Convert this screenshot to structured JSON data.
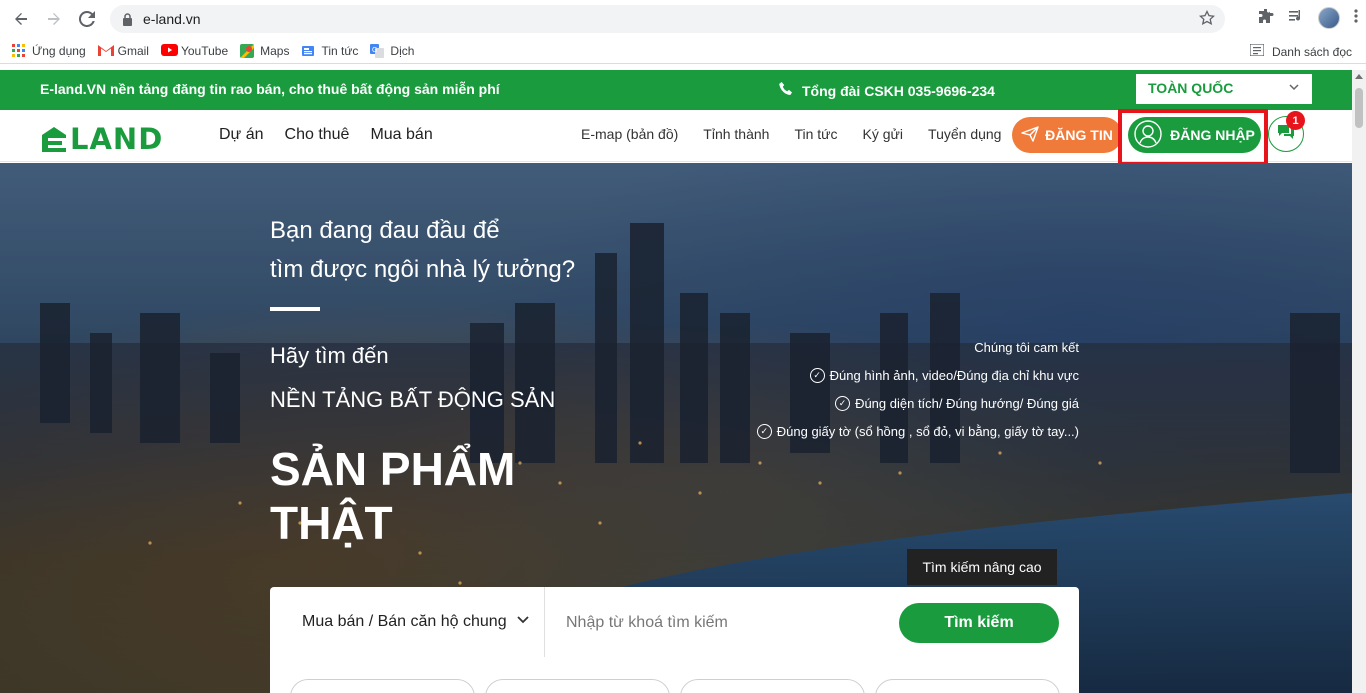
{
  "browser": {
    "url": "e-land.vn",
    "bookmarks": [
      {
        "label": "Ứng dụng",
        "icon": "apps-grid-icon"
      },
      {
        "label": "Gmail",
        "icon": "gmail-icon"
      },
      {
        "label": "YouTube",
        "icon": "youtube-icon"
      },
      {
        "label": "Maps",
        "icon": "maps-icon"
      },
      {
        "label": "Tin tức",
        "icon": "news-icon"
      },
      {
        "label": "Dịch",
        "icon": "translate-icon"
      }
    ],
    "reading_list": "Danh sách đọc"
  },
  "topbar": {
    "tagline": "E-land.VN nền tảng đăng tin rao bán, cho thuê bất động sản miễn phí",
    "hotline": "Tổng đài CSKH 035-9696-234",
    "region": "TOÀN QUỐC"
  },
  "header": {
    "logo": "LAND",
    "main_nav": [
      "Dự án",
      "Cho thuê",
      "Mua bán"
    ],
    "sub_nav": [
      "E-map (bản đồ)",
      "Tỉnh thành",
      "Tin tức",
      "Ký gửi",
      "Tuyển dụng"
    ],
    "post_label": "ĐĂNG TIN",
    "login_label": "ĐĂNG NHẬP",
    "chat_badge": "1"
  },
  "hero": {
    "line1": "Bạn đang đau đầu để",
    "line2": "tìm được ngôi nhà lý tưởng?",
    "line3": "Hãy tìm đến",
    "line4": "NỀN TẢNG BẤT ĐỘNG SẢN",
    "big1": "SẢN PHẨM",
    "big2": "THẬT",
    "commit_title": "Chúng tôi cam kết",
    "commits": [
      "Đúng hình ảnh, video/Đúng địa chỉ khu vực",
      "Đúng diện tích/ Đúng hướng/ Đúng giá",
      "Đúng giấy tờ (sổ hồng , sổ đỏ, vi bằng, giấy tờ tay...)"
    ],
    "advanced_search": "Tìm kiếm nâng cao"
  },
  "search": {
    "type_value": "Mua bán / Bán căn hộ chung",
    "placeholder": "Nhập từ khoá tìm kiếm",
    "button": "Tìm kiếm"
  },
  "colors": {
    "brand_green": "#1a9c3e",
    "post_orange": "#f07a3a",
    "highlight_red": "#e8141b"
  }
}
